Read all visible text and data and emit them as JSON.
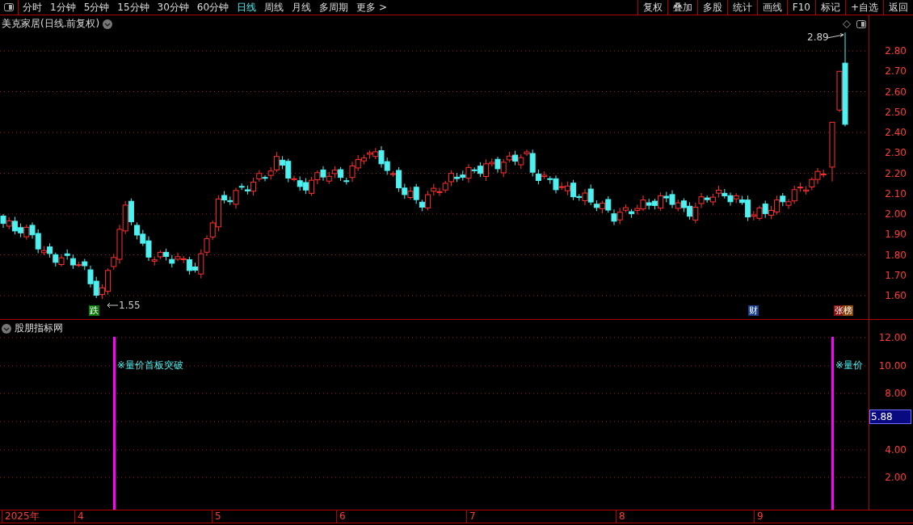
{
  "toolbar": {
    "periods": [
      {
        "label": "分时",
        "selected": false
      },
      {
        "label": "1分钟",
        "selected": false
      },
      {
        "label": "5分钟",
        "selected": false
      },
      {
        "label": "15分钟",
        "selected": false
      },
      {
        "label": "30分钟",
        "selected": false
      },
      {
        "label": "60分钟",
        "selected": false
      },
      {
        "label": "日线",
        "selected": true
      },
      {
        "label": "周线",
        "selected": false
      },
      {
        "label": "月线",
        "selected": false
      },
      {
        "label": "多周期",
        "selected": false
      }
    ],
    "more": "更多 >",
    "buttons": [
      "复权",
      "叠加",
      "多股",
      "统计",
      "画线",
      "F10",
      "标记",
      "+自选",
      "返回"
    ]
  },
  "chart": {
    "title": "美克家居(日线.前复权)",
    "high_label": "2.89",
    "low_label": "1.55",
    "price_axis": [
      "2.80",
      "2.70",
      "2.60",
      "2.50",
      "2.40",
      "2.30",
      "2.20",
      "2.10",
      "2.00",
      "1.90",
      "1.80",
      "1.70",
      "1.60"
    ],
    "markers": [
      {
        "label": "跌",
        "color": "#0a7a0a"
      },
      {
        "label": "财",
        "color": "#1a3f8a"
      },
      {
        "label": "张",
        "color": "#8a1010"
      },
      {
        "label": "榜",
        "color": "#8a4a10"
      }
    ]
  },
  "indicator": {
    "title": "股朋指标网",
    "signal_label": "※量价首板突破",
    "signal_label_cut": "※量价",
    "axis": [
      "12.00",
      "10.00",
      "8.00",
      "4.00",
      "2.00"
    ],
    "current_value": "5.88"
  },
  "time_axis": [
    "2025年",
    "4",
    "5",
    "6",
    "7",
    "8",
    "9"
  ]
}
